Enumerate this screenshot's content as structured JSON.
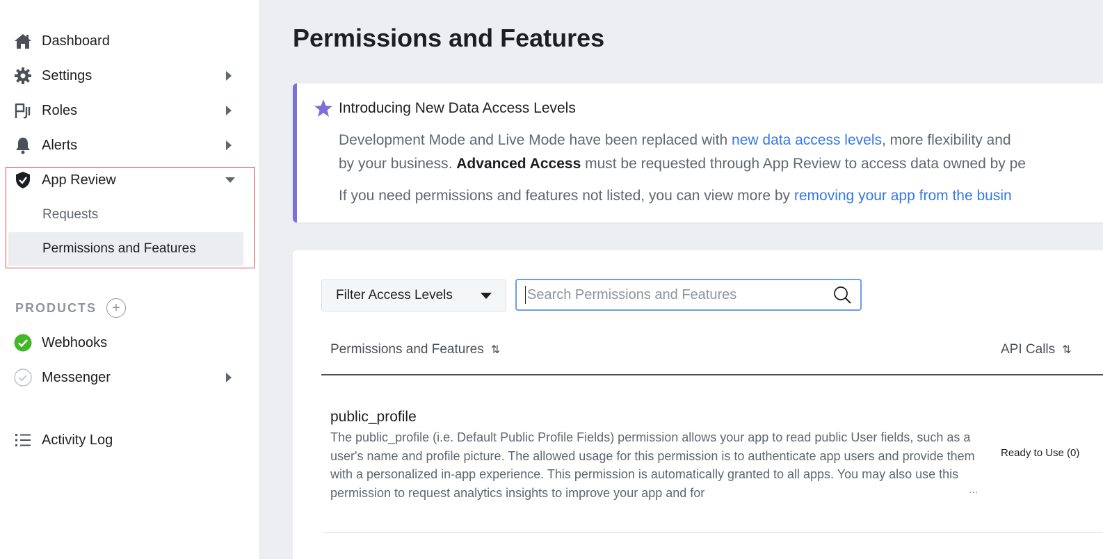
{
  "sidebar": {
    "items": [
      {
        "label": "Dashboard",
        "icon": "home-icon"
      },
      {
        "label": "Settings",
        "icon": "gear-icon"
      },
      {
        "label": "Roles",
        "icon": "roles-icon"
      },
      {
        "label": "Alerts",
        "icon": "bell-icon"
      },
      {
        "label": "App Review",
        "icon": "shield-icon"
      }
    ],
    "app_review_sub": [
      {
        "label": "Requests"
      },
      {
        "label": "Permissions and Features",
        "active": true
      }
    ],
    "products_heading": "PRODUCTS",
    "products": [
      {
        "label": "Webhooks",
        "icon": "check-circle-icon",
        "status": "active"
      },
      {
        "label": "Messenger",
        "icon": "check-circle-outline-icon"
      }
    ],
    "activity_log": {
      "label": "Activity Log",
      "icon": "list-icon"
    }
  },
  "main": {
    "title": "Permissions and Features",
    "banner": {
      "title": "Introducing New Data Access Levels",
      "line1_pre": "Development Mode and Live Mode have been replaced with ",
      "line1_link": "new data access levels",
      "line1_post": ", more flexibility and",
      "line2_pre": "by your business. ",
      "line2_bold": "Advanced Access",
      "line2_post": " must be requested through App Review to access data owned by pe",
      "line3_pre": "If you need permissions and features not listed, you can view more by ",
      "line3_link": "removing your app from the busin"
    },
    "filter": {
      "label": "Filter Access Levels"
    },
    "search": {
      "placeholder": "Search Permissions and Features",
      "value": ""
    },
    "table": {
      "columns": [
        "Permissions and Features",
        "API Calls"
      ],
      "sort_glyph": "⇅",
      "rows": [
        {
          "name": "public_profile",
          "description": "The public_profile (i.e. Default Public Profile Fields) permission allows your app to read public User fields, such as a user's name and profile picture. The allowed usage for this permission is to authenticate app users and provide them with a personalized in-app experience. This permission is automatically granted to all apps. You may also use this permission to request analytics insights to improve your app and for",
          "ellipsis": "...",
          "api_calls": "Ready to Use (0)"
        }
      ]
    }
  },
  "colors": {
    "accent": "#7d6fd6",
    "link": "#3578e5",
    "highlight_border": "#e0474c",
    "success": "#42b72a",
    "background": "#edeef2"
  }
}
